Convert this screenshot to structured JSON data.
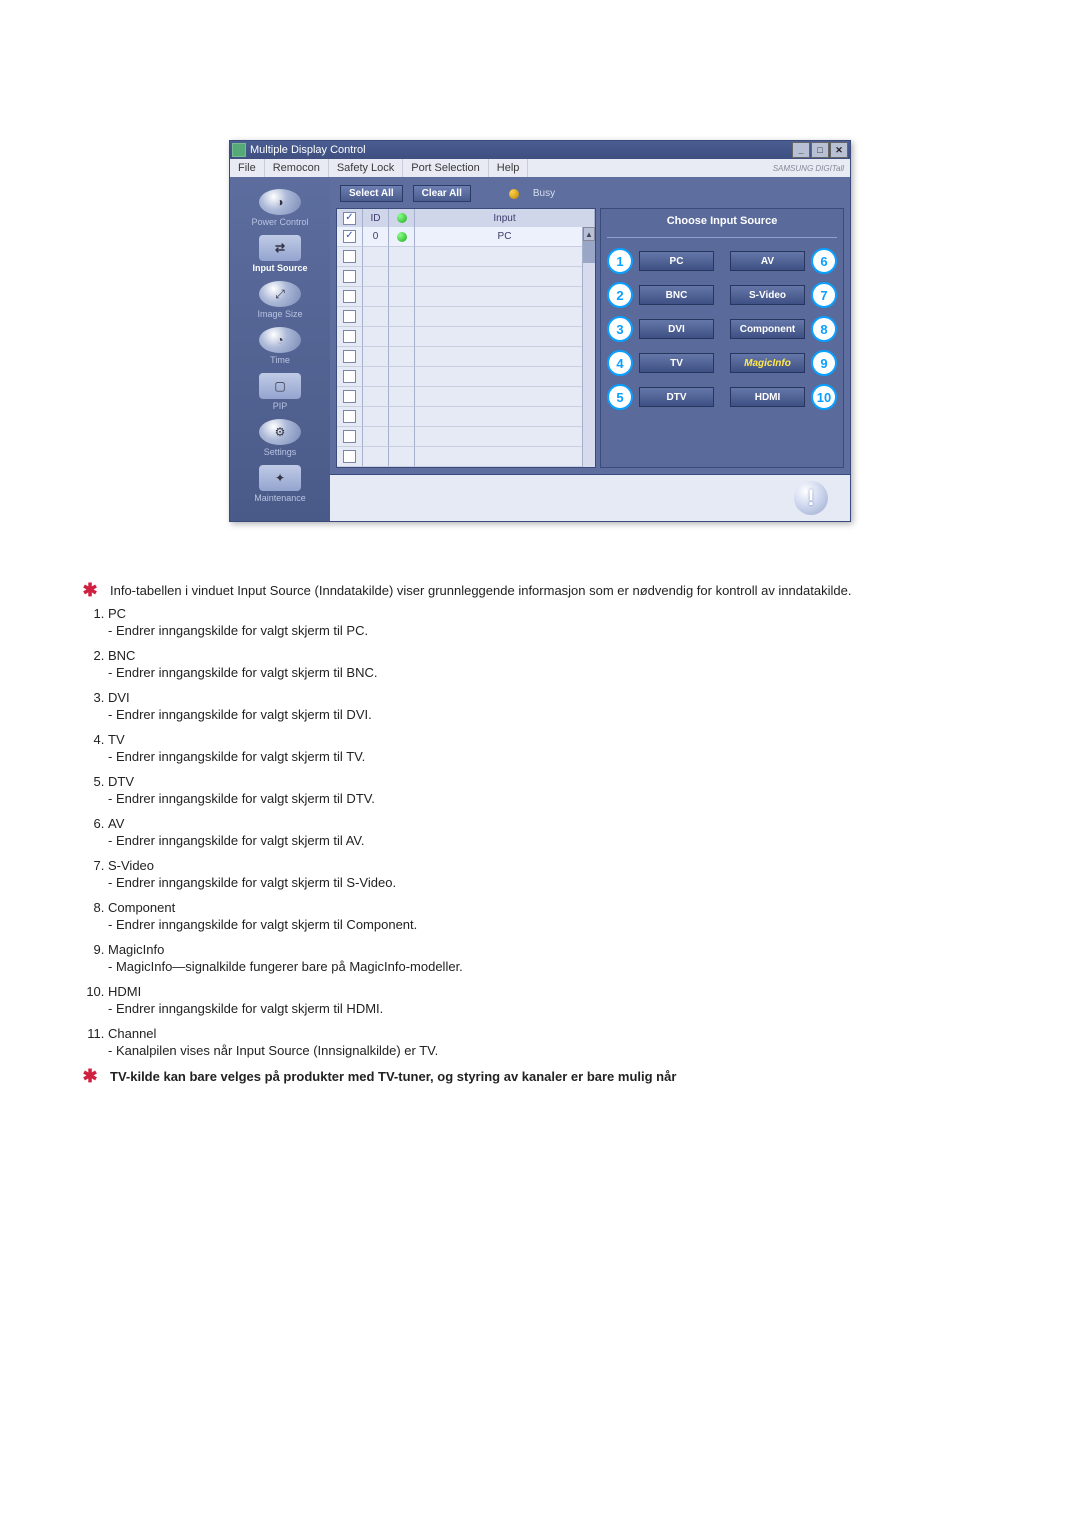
{
  "window": {
    "title": "Multiple Display Control",
    "menu": [
      "File",
      "Remocon",
      "Safety Lock",
      "Port Selection",
      "Help"
    ],
    "brand": "SAMSUNG DIGITall"
  },
  "sidebar": [
    {
      "label": "Power Control",
      "icon": "◑"
    },
    {
      "label": "Input Source",
      "icon": "▭",
      "active": true
    },
    {
      "label": "Image Size",
      "icon": "◐"
    },
    {
      "label": "Time",
      "icon": "◉"
    },
    {
      "label": "PIP",
      "icon": "▭"
    },
    {
      "label": "Settings",
      "icon": "◐"
    },
    {
      "label": "Maintenance",
      "icon": "▭"
    }
  ],
  "toolbar": {
    "select_all": "Select All",
    "clear_all": "Clear All",
    "busy": "Busy"
  },
  "grid": {
    "headers": {
      "id": "ID",
      "input": "Input"
    },
    "rows": [
      {
        "checked": true,
        "id": "0",
        "led": "green",
        "input": "PC"
      },
      {
        "checked": false
      },
      {
        "checked": false
      },
      {
        "checked": false
      },
      {
        "checked": false
      },
      {
        "checked": false
      },
      {
        "checked": false
      },
      {
        "checked": false
      },
      {
        "checked": false
      },
      {
        "checked": false
      },
      {
        "checked": false
      },
      {
        "checked": false
      }
    ]
  },
  "panel": {
    "header": "Choose Input Source",
    "left": [
      {
        "n": "1",
        "label": "PC"
      },
      {
        "n": "2",
        "label": "BNC"
      },
      {
        "n": "3",
        "label": "DVI"
      },
      {
        "n": "4",
        "label": "TV"
      },
      {
        "n": "5",
        "label": "DTV"
      }
    ],
    "right": [
      {
        "n": "6",
        "label": "AV"
      },
      {
        "n": "7",
        "label": "S-Video"
      },
      {
        "n": "8",
        "label": "Component"
      },
      {
        "n": "9",
        "label": "MagicInfo",
        "magic": true
      },
      {
        "n": "10",
        "label": "HDMI"
      }
    ]
  },
  "note_top": "Info-tabellen i vinduet Input Source (Inndatakilde) viser grunnleggende informasjon som er nødvendig for kontroll av inndatakilde.",
  "list": [
    {
      "hd": "PC",
      "sub": "- Endrer inngangskilde for valgt skjerm til PC."
    },
    {
      "hd": "BNC",
      "sub": "- Endrer inngangskilde for valgt skjerm til BNC."
    },
    {
      "hd": "DVI",
      "sub": "- Endrer inngangskilde for valgt skjerm til DVI."
    },
    {
      "hd": "TV",
      "sub": "- Endrer inngangskilde for valgt skjerm til TV."
    },
    {
      "hd": "DTV",
      "sub": "- Endrer inngangskilde for valgt skjerm til DTV."
    },
    {
      "hd": "AV",
      "sub": "- Endrer inngangskilde for valgt skjerm til AV."
    },
    {
      "hd": "S-Video",
      "sub": "- Endrer inngangskilde for valgt skjerm til S-Video."
    },
    {
      "hd": "Component",
      "sub": "- Endrer inngangskilde for valgt skjerm til Component."
    },
    {
      "hd": "MagicInfo",
      "sub": "- MagicInfo—signalkilde fungerer bare på MagicInfo-modeller."
    },
    {
      "hd": "HDMI",
      "sub": "- Endrer inngangskilde for valgt skjerm til HDMI."
    },
    {
      "hd": "Channel",
      "sub": "- Kanalpilen vises når Input Source (Innsignalkilde) er TV."
    }
  ],
  "note_bottom": "TV-kilde kan bare velges på produkter med TV-tuner, og styring av kanaler er bare mulig når"
}
